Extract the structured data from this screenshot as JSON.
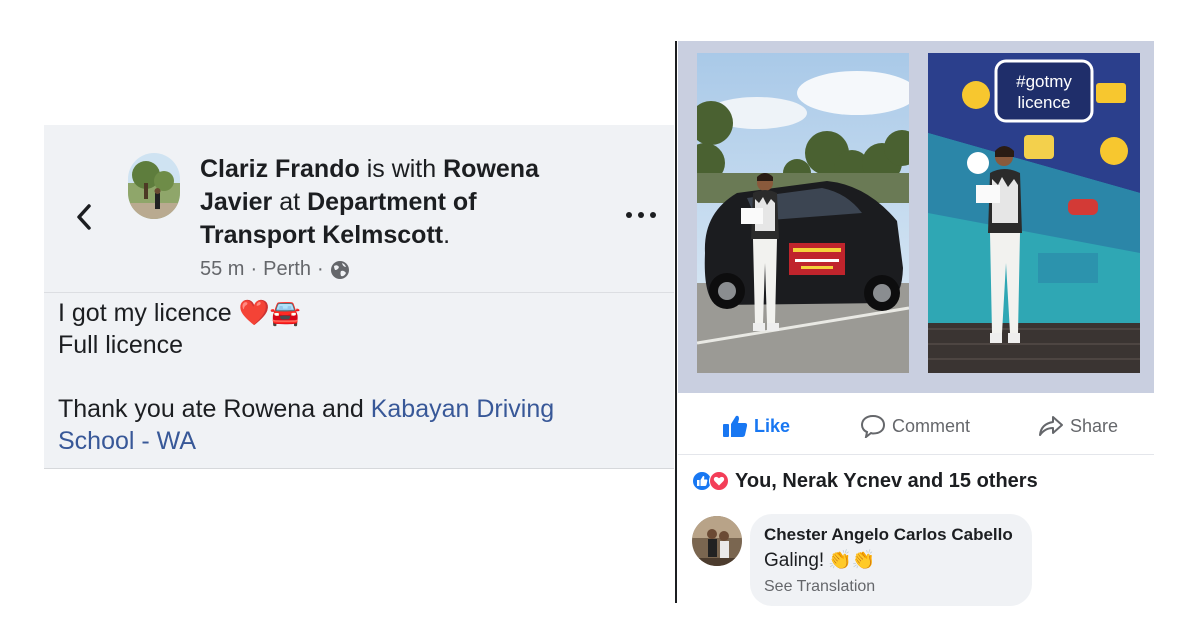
{
  "post": {
    "author": "Clariz Frando",
    "with_word": "is with",
    "tagged_first": "Rowena",
    "tagged_last": "Javier",
    "at_word": "at",
    "place_line1": "Department of",
    "place_line2": "Transport Kelmscott",
    "place_end": ".",
    "time": "55 m",
    "location": "Perth",
    "separator": "·",
    "body_line1": "I got my licence",
    "body_emoji": "❤️🚘",
    "body_line2": "Full licence",
    "thanks_text": "Thank you ate Rowena and ",
    "thanks_link_line1": "Kabayan Driving",
    "thanks_link_line2": "School - WA"
  },
  "photos": {
    "photo2_sign_line1": "#gotmy",
    "photo2_sign_line2": "licence"
  },
  "actions": {
    "like": "Like",
    "comment": "Comment",
    "share": "Share"
  },
  "reactions": {
    "text": "You, Nerak Ycnev and 15 others"
  },
  "comment": {
    "author": "Chester Angelo Carlos Cabello",
    "text": "Galing!",
    "emoji": "👏👏",
    "see_translation": "See Translation"
  },
  "colors": {
    "link_blue": "#385898",
    "like_blue": "#1877f2",
    "love_red": "#f33e58",
    "meta_gray": "#65676b",
    "panel_bg": "#f0f2f5"
  }
}
